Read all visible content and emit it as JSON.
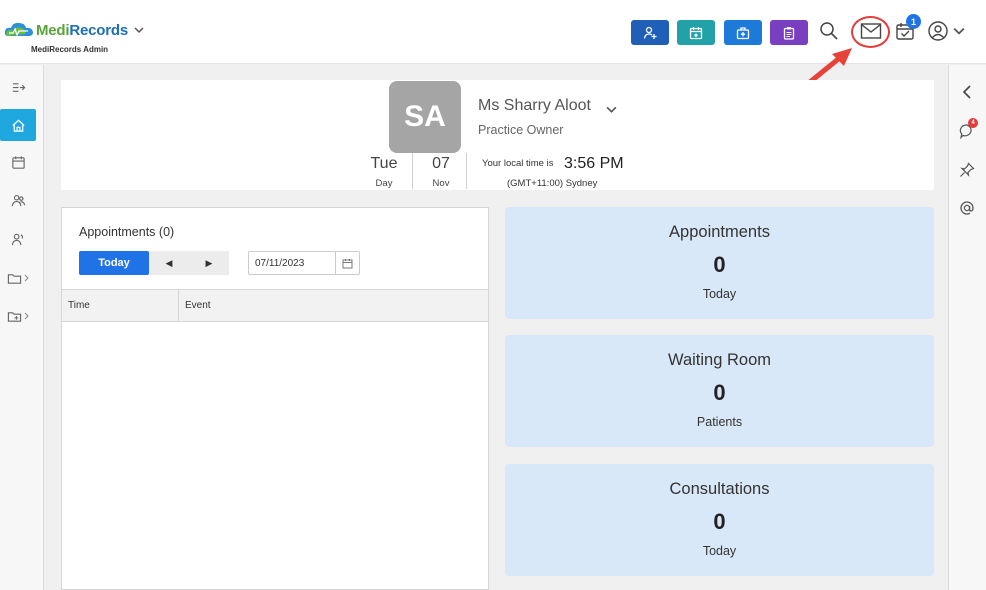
{
  "app": {
    "brand_part1": "Medi",
    "brand_part2": "Records",
    "subtitle": "MediRecords Admin"
  },
  "toolbar": {
    "buttons": [
      {
        "icon": "add-patient-icon",
        "color": "#1f5fb8"
      },
      {
        "icon": "calendar-icon",
        "color": "#22a1a8"
      },
      {
        "icon": "medical-bag-icon",
        "color": "#1e7ad9"
      },
      {
        "icon": "clipboard-icon",
        "color": "#7a3fc1"
      }
    ],
    "tasks_badge": "1"
  },
  "left_sidebar": {
    "items": [
      "expand-icon",
      "home-icon",
      "calendar-icon",
      "patients-icon",
      "users-icon",
      "folder-icon",
      "folder-share-icon"
    ]
  },
  "right_sidebar": {
    "items": [
      "chevron-left-icon",
      "chat-icon",
      "pin-icon",
      "at-icon"
    ],
    "chat_badge": "4"
  },
  "profile": {
    "initials": "SA",
    "name": "Ms Sharry Aloot",
    "role": "Practice Owner",
    "day": "Tue",
    "day_label": "Day",
    "date": "07",
    "month_label": "Nov",
    "time_label": "Your local time is",
    "time": "3:56 PM",
    "timezone": "(GMT+11:00) Sydney"
  },
  "appointments_panel": {
    "title": "Appointments (0)",
    "today_button": "Today",
    "prev_symbol": "◀",
    "next_symbol": "▶",
    "date_value": "07/11/2023",
    "columns": [
      "Time",
      "Event"
    ]
  },
  "stats": [
    {
      "title": "Appointments",
      "value": "0",
      "subtitle": "Today"
    },
    {
      "title": "Waiting Room",
      "value": "0",
      "subtitle": "Patients"
    },
    {
      "title": "Consultations",
      "value": "0",
      "subtitle": "Today"
    }
  ],
  "colors": {
    "accent": "#1f73e6",
    "sidebar_active": "#1fa7e0",
    "card": "#d9e8f8",
    "highlight": "#e63b3b"
  }
}
